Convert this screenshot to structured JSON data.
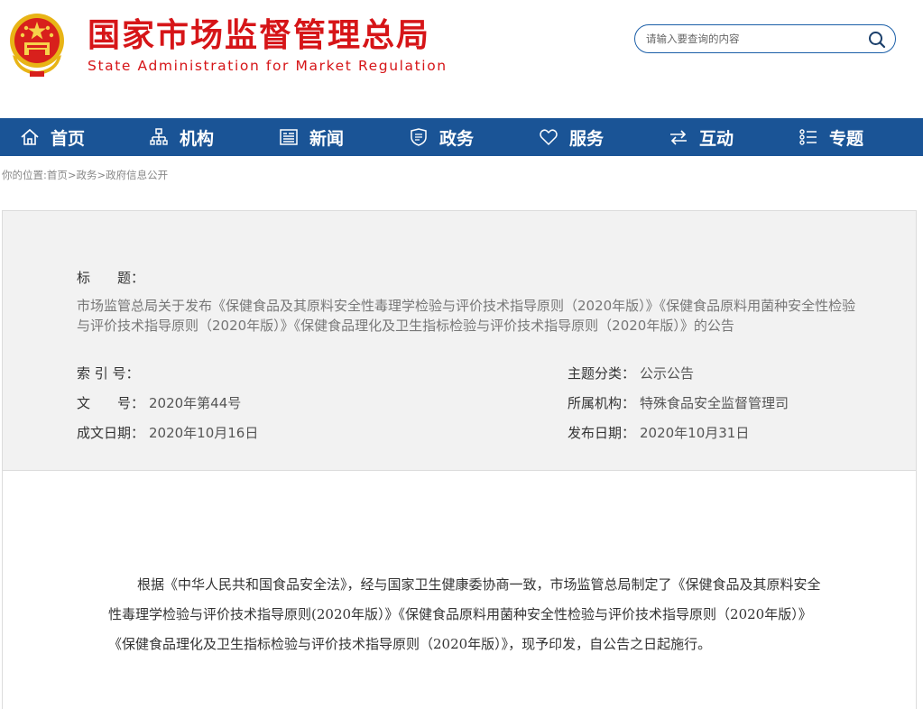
{
  "header": {
    "title": "国家市场监督管理总局",
    "subtitle": "State Administration for Market Regulation",
    "brand_color": "#d61518",
    "search_placeholder": "请输入要查询的内容",
    "search_icon": "search-icon"
  },
  "nav": {
    "bg_color": "#1a5496",
    "items": [
      {
        "label": "首页",
        "icon": "home-icon"
      },
      {
        "label": "机构",
        "icon": "org-chart-icon"
      },
      {
        "label": "新闻",
        "icon": "news-icon"
      },
      {
        "label": "政务",
        "icon": "shield-icon"
      },
      {
        "label": "服务",
        "icon": "heart-icon"
      },
      {
        "label": "互动",
        "icon": "exchange-icon"
      },
      {
        "label": "专题",
        "icon": "list-icon"
      }
    ]
  },
  "breadcrumb": {
    "prefix": "你的位置:",
    "items": [
      "首页",
      "政务",
      "政府信息公开"
    ],
    "separator": ">"
  },
  "meta": {
    "title_label": "标　　题：",
    "title_value": "市场监管总局关于发布《保健食品及其原料安全性毒理学检验与评价技术指导原则（2020年版）》《保健食品原料用菌种安全性检验与评价技术指导原则（2020年版）》《保健食品理化及卫生指标检验与评价技术指导原则（2020年版）》的公告",
    "index_label": "索 引 号：",
    "index_value": "",
    "topic_label": "主题分类：",
    "topic_value": "公示公告",
    "doc_no_label": "文　　号：",
    "doc_no_value": "2020年第44号",
    "agency_label": "所属机构：",
    "agency_value": "特殊食品安全监督管理司",
    "date_written_label": "成文日期：",
    "date_written_value": "2020年10月16日",
    "date_published_label": "发布日期：",
    "date_published_value": "2020年10月31日"
  },
  "body": {
    "paragraph": "根据《中华人民共和国食品安全法》，经与国家卫生健康委协商一致，市场监管总局制定了《保健食品及其原料安全性毒理学检验与评价技术指导原则(2020年版）》《保健食品原料用菌种安全性检验与评价技术指导原则（2020年版）》《保健食品理化及卫生指标检验与评价技术指导原则（2020年版）》，现予印发，自公告之日起施行。"
  }
}
